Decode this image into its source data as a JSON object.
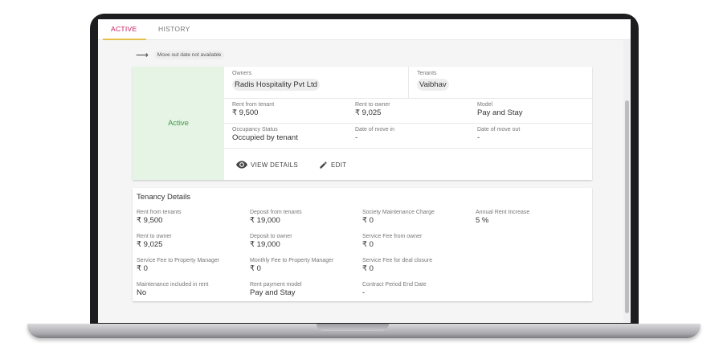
{
  "tabs": [
    {
      "label": "ACTIVE",
      "active": true
    },
    {
      "label": "HISTORY",
      "active": false
    }
  ],
  "move_out_note": "Move out date not available",
  "status": {
    "label": "Active",
    "color": "#3f9a43",
    "background": "#e6f4e6"
  },
  "owners": {
    "label": "Owners",
    "value": "Radis Hospitality Pvt Ltd"
  },
  "tenants": {
    "label": "Tenants",
    "value": "Vaibhav"
  },
  "summary": {
    "rent_from_tenant": {
      "label": "Rent from tenant",
      "value": "₹ 9,500"
    },
    "rent_to_owner": {
      "label": "Rent to owner",
      "value": "₹ 9,025"
    },
    "model": {
      "label": "Model",
      "value": "Pay and Stay"
    },
    "occupancy_status": {
      "label": "Occupancy Status",
      "value": "Occupied by tenant"
    },
    "date_move_in": {
      "label": "Date of move in",
      "value": "-"
    },
    "date_move_out": {
      "label": "Date of move out",
      "value": "-"
    }
  },
  "actions": {
    "view_details": "VIEW DETAILS",
    "edit": "EDIT"
  },
  "tenancy_details": {
    "title": "Tenancy Details",
    "fields": [
      {
        "label": "Rent from tenants",
        "value": "₹ 9,500"
      },
      {
        "label": "Deposit from tenants",
        "value": "₹ 19,000"
      },
      {
        "label": "Society Maintenance Charge",
        "value": "₹ 0"
      },
      {
        "label": "Annual Rent Increase",
        "value": "5 %"
      },
      {
        "label": "Rent to owner",
        "value": "₹ 9,025"
      },
      {
        "label": "Deposit to owner",
        "value": "₹ 19,000"
      },
      {
        "label": "Service Fee from owner",
        "value": "₹ 0"
      },
      {
        "label": "Service Fee to Property Manager",
        "value": "₹ 0"
      },
      {
        "label": "Monthly Fee to Property Manager",
        "value": "₹ 0"
      },
      {
        "label": "Service Fee for deal closure",
        "value": "₹ 0"
      },
      {
        "label": "Maintenance included in rent",
        "value": "No"
      },
      {
        "label": "Rent payment model",
        "value": "Pay and Stay"
      },
      {
        "label": "Contract Period End Date",
        "value": "-"
      }
    ]
  },
  "colors": {
    "accent_tab": "#c2185b",
    "tab_underline": "#e7c04a"
  }
}
